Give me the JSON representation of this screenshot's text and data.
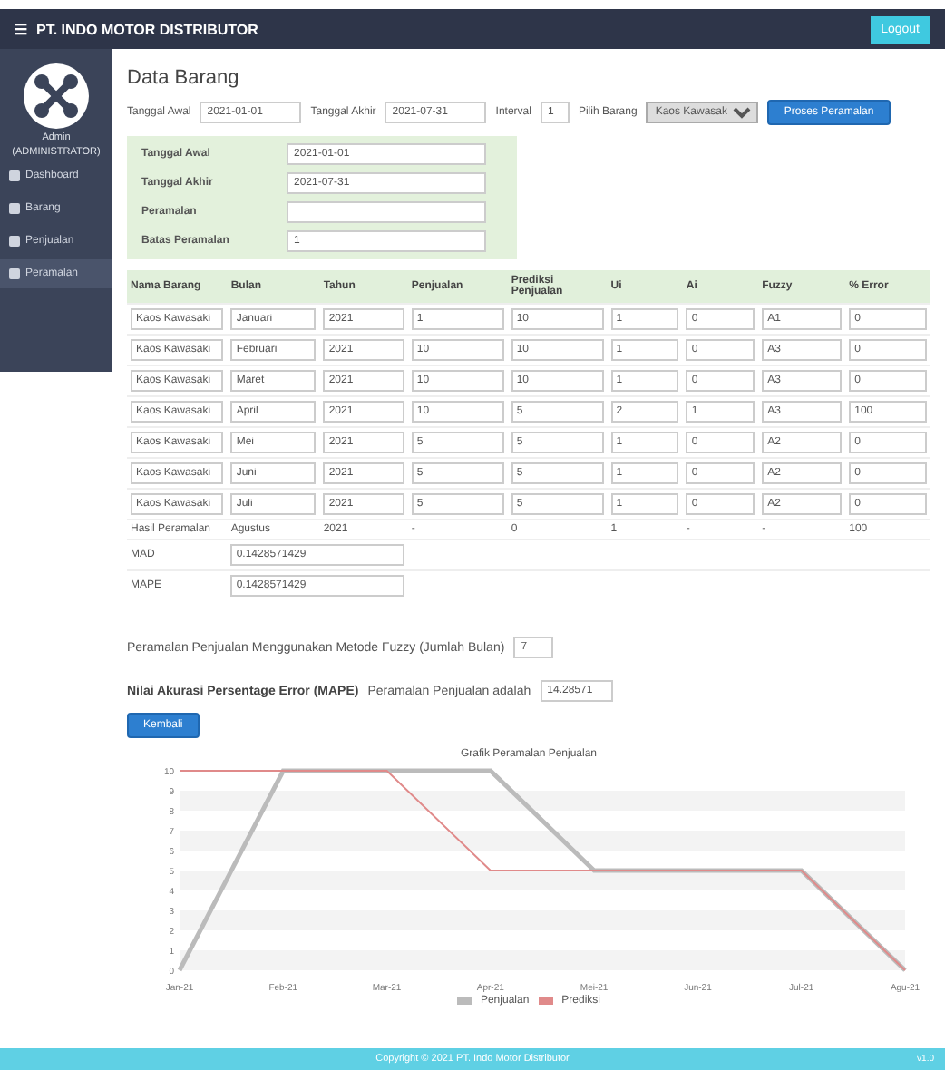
{
  "header": {
    "menu_glyph": "☰",
    "title": "PT. INDO MOTOR DISTRIBUTOR",
    "logout": "Logout"
  },
  "sidebar": {
    "user_name": "Admin",
    "user_role": "(ADMINISTRATOR)",
    "items": [
      {
        "label": "Dashboard",
        "selected": false
      },
      {
        "label": "Barang",
        "selected": false
      },
      {
        "label": "Penjualan",
        "selected": false
      },
      {
        "label": "Peramalan",
        "selected": true
      }
    ]
  },
  "page_title": "Data Barang",
  "filters": [
    {
      "label": "Tanggal Awal",
      "value": "2021-01-01",
      "kind": "input"
    },
    {
      "label": "Tanggal Akhir",
      "value": "2021-07-31",
      "kind": "input"
    },
    {
      "label": "Interval",
      "value": "1",
      "kind": "small"
    },
    {
      "label": "Pilih Barang",
      "value": "Kaos Kawasaki",
      "kind": "select"
    }
  ],
  "filter_button": "Proses Peramalan",
  "summary": [
    {
      "label": "Tanggal Awal",
      "value": "2021-01-01"
    },
    {
      "label": "Tanggal Akhir",
      "value": "2021-07-31"
    },
    {
      "label": "Peramalan"
    },
    {
      "label": "Batas Peramalan",
      "value": "1"
    }
  ],
  "table": {
    "columns": [
      "Nama Barang",
      "Bulan",
      "Tahun",
      "Penjualan",
      "Prediksi Penjualan",
      "Ui",
      "Ai",
      "Fuzzy",
      "% Error"
    ],
    "rows": [
      {
        "kind": "input",
        "cells": [
          "Kaos Kawasaki",
          "Januari",
          "2021",
          "1",
          "10",
          "1",
          "0",
          "A1",
          "0"
        ]
      },
      {
        "kind": "input",
        "cells": [
          "Kaos Kawasaki",
          "Februari",
          "2021",
          "10",
          "10",
          "1",
          "0",
          "A3",
          "0"
        ]
      },
      {
        "kind": "input",
        "cells": [
          "Kaos Kawasaki",
          "Maret",
          "2021",
          "10",
          "10",
          "1",
          "0",
          "A3",
          "0"
        ]
      },
      {
        "kind": "input",
        "cells": [
          "Kaos Kawasaki",
          "April",
          "2021",
          "10",
          "5",
          "2",
          "1",
          "A3",
          "100"
        ]
      },
      {
        "kind": "input",
        "cells": [
          "Kaos Kawasaki",
          "Mei",
          "2021",
          "5",
          "5",
          "1",
          "0",
          "A2",
          "0"
        ]
      },
      {
        "kind": "input",
        "cells": [
          "Kaos Kawasaki",
          "Juni",
          "2021",
          "5",
          "5",
          "1",
          "0",
          "A2",
          "0"
        ]
      },
      {
        "kind": "input",
        "cells": [
          "Kaos Kawasaki",
          "Juli",
          "2021",
          "5",
          "5",
          "1",
          "0",
          "A2",
          "0"
        ]
      },
      {
        "kind": "text",
        "cells": [
          "Hasil Peramalan",
          "Agustus",
          "2021",
          "-",
          "0",
          "1",
          "-",
          "-",
          "100"
        ]
      }
    ]
  },
  "metrics": [
    {
      "label": "MAD",
      "value": "0.1428571429"
    },
    {
      "label": "MAPE",
      "value": "0.1428571429"
    }
  ],
  "periods": {
    "label": "Peramalan Penjualan Menggunakan Metode Fuzzy (Jumlah Bulan)",
    "value": "7"
  },
  "accuracy": {
    "label": "Nilai Akurasi Persentage Error (MAPE)",
    "suffix": "Peramalan Penjualan adalah",
    "value": "14.28571"
  },
  "back_button": "Kembali",
  "chart_data": {
    "type": "line",
    "title": "Grafik Peramalan Penjualan",
    "categories": [
      "Jan-21",
      "Feb-21",
      "Mar-21",
      "Apr-21",
      "Mei-21",
      "Jun-21",
      "Jul-21",
      "Agu-21"
    ],
    "series": [
      {
        "name": "Penjualan",
        "color": "#bbbbbb",
        "values": [
          0,
          10,
          10,
          10,
          5,
          5,
          5,
          0
        ]
      },
      {
        "name": "Prediksi",
        "color": "#e08a8a",
        "values": [
          10,
          10,
          10,
          5,
          5,
          5,
          5,
          0
        ]
      }
    ],
    "ylim": [
      0,
      10
    ],
    "yticks": [
      0,
      1,
      2,
      3,
      4,
      5,
      6,
      7,
      8,
      9,
      10
    ]
  },
  "footer": {
    "text": "Copyright © 2021 PT. Indo Motor Distributor",
    "version": "v1.0"
  }
}
